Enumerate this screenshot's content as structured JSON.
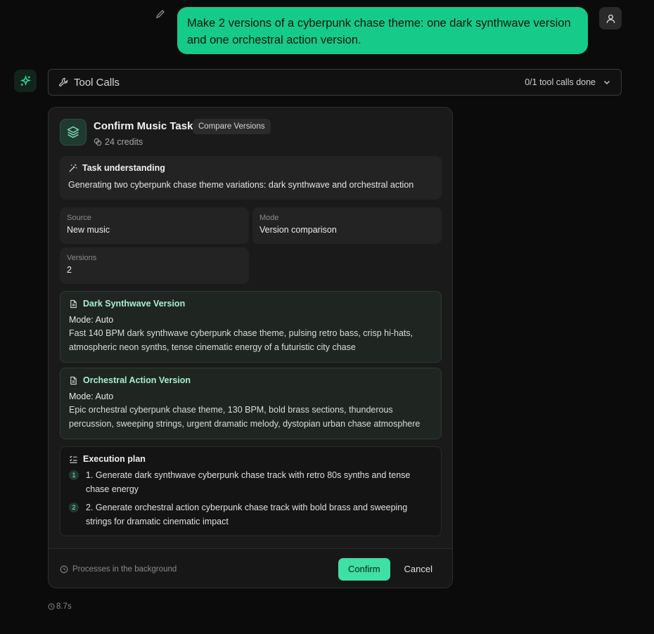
{
  "user_message": {
    "text": "Make 2 versions of a cyberpunk chase theme: one dark synthwave version and one orchestral action version.",
    "accent": "#16cb8a"
  },
  "tool_calls": {
    "title": "Tool Calls",
    "status": "0/1 tool calls done"
  },
  "task_card": {
    "title": "Confirm Music Task",
    "badge": "Compare Versions",
    "credits": "24 credits",
    "understanding": {
      "label": "Task understanding",
      "text": "Generating two cyberpunk chase theme variations: dark synthwave and orchestral action"
    },
    "meta": {
      "source_label": "Source",
      "source_value": "New music",
      "mode_label": "Mode",
      "mode_value": "Version comparison",
      "versions_label": "Versions",
      "versions_value": "2"
    },
    "versions": [
      {
        "title": "Dark Synthwave Version",
        "mode": "Mode: Auto",
        "prompt": "Fast 140 BPM dark synthwave cyberpunk chase theme, pulsing retro bass, crisp hi-hats, atmospheric neon synths, tense cinematic energy of a futuristic city chase"
      },
      {
        "title": "Orchestral Action Version",
        "mode": "Mode: Auto",
        "prompt": "Epic orchestral cyberpunk chase theme, 130 BPM, bold brass sections, thunderous percussion, sweeping strings, urgent dramatic melody, dystopian urban chase atmosphere"
      }
    ],
    "plan": {
      "label": "Execution plan",
      "steps": [
        {
          "num": "1",
          "text": "1. Generate dark synthwave cyberpunk chase track with retro 80s synths and tense chase energy"
        },
        {
          "num": "2",
          "text": "2. Generate orchestral action cyberpunk chase track with bold brass and sweeping strings for dramatic cinematic impact"
        }
      ]
    },
    "footer": {
      "background_note": "Processes in the background",
      "confirm_label": "Confirm",
      "cancel_label": "Cancel",
      "confirm_color": "#3fe0a3"
    }
  },
  "elapsed": "8.7s"
}
